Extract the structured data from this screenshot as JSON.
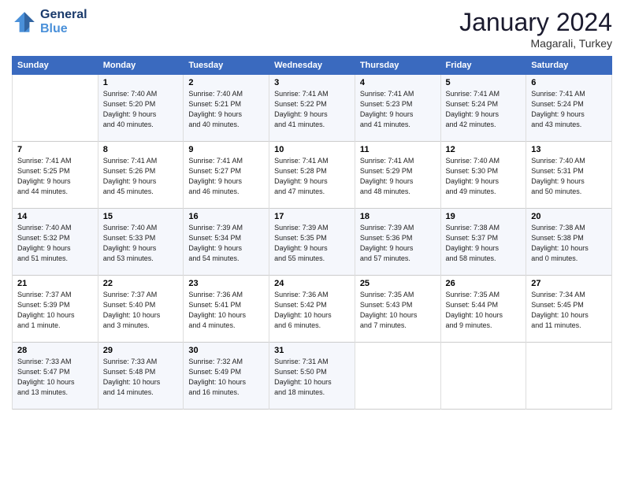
{
  "header": {
    "logo_line1": "General",
    "logo_line2": "Blue",
    "month_title": "January 2024",
    "location": "Magarali, Turkey"
  },
  "columns": [
    "Sunday",
    "Monday",
    "Tuesday",
    "Wednesday",
    "Thursday",
    "Friday",
    "Saturday"
  ],
  "weeks": [
    [
      {
        "day": "",
        "sunrise": "",
        "sunset": "",
        "daylight": ""
      },
      {
        "day": "1",
        "sunrise": "Sunrise: 7:40 AM",
        "sunset": "Sunset: 5:20 PM",
        "daylight": "Daylight: 9 hours and 40 minutes."
      },
      {
        "day": "2",
        "sunrise": "Sunrise: 7:40 AM",
        "sunset": "Sunset: 5:21 PM",
        "daylight": "Daylight: 9 hours and 40 minutes."
      },
      {
        "day": "3",
        "sunrise": "Sunrise: 7:41 AM",
        "sunset": "Sunset: 5:22 PM",
        "daylight": "Daylight: 9 hours and 41 minutes."
      },
      {
        "day": "4",
        "sunrise": "Sunrise: 7:41 AM",
        "sunset": "Sunset: 5:23 PM",
        "daylight": "Daylight: 9 hours and 41 minutes."
      },
      {
        "day": "5",
        "sunrise": "Sunrise: 7:41 AM",
        "sunset": "Sunset: 5:24 PM",
        "daylight": "Daylight: 9 hours and 42 minutes."
      },
      {
        "day": "6",
        "sunrise": "Sunrise: 7:41 AM",
        "sunset": "Sunset: 5:24 PM",
        "daylight": "Daylight: 9 hours and 43 minutes."
      }
    ],
    [
      {
        "day": "7",
        "sunrise": "Sunrise: 7:41 AM",
        "sunset": "Sunset: 5:25 PM",
        "daylight": "Daylight: 9 hours and 44 minutes."
      },
      {
        "day": "8",
        "sunrise": "Sunrise: 7:41 AM",
        "sunset": "Sunset: 5:26 PM",
        "daylight": "Daylight: 9 hours and 45 minutes."
      },
      {
        "day": "9",
        "sunrise": "Sunrise: 7:41 AM",
        "sunset": "Sunset: 5:27 PM",
        "daylight": "Daylight: 9 hours and 46 minutes."
      },
      {
        "day": "10",
        "sunrise": "Sunrise: 7:41 AM",
        "sunset": "Sunset: 5:28 PM",
        "daylight": "Daylight: 9 hours and 47 minutes."
      },
      {
        "day": "11",
        "sunrise": "Sunrise: 7:41 AM",
        "sunset": "Sunset: 5:29 PM",
        "daylight": "Daylight: 9 hours and 48 minutes."
      },
      {
        "day": "12",
        "sunrise": "Sunrise: 7:40 AM",
        "sunset": "Sunset: 5:30 PM",
        "daylight": "Daylight: 9 hours and 49 minutes."
      },
      {
        "day": "13",
        "sunrise": "Sunrise: 7:40 AM",
        "sunset": "Sunset: 5:31 PM",
        "daylight": "Daylight: 9 hours and 50 minutes."
      }
    ],
    [
      {
        "day": "14",
        "sunrise": "Sunrise: 7:40 AM",
        "sunset": "Sunset: 5:32 PM",
        "daylight": "Daylight: 9 hours and 51 minutes."
      },
      {
        "day": "15",
        "sunrise": "Sunrise: 7:40 AM",
        "sunset": "Sunset: 5:33 PM",
        "daylight": "Daylight: 9 hours and 53 minutes."
      },
      {
        "day": "16",
        "sunrise": "Sunrise: 7:39 AM",
        "sunset": "Sunset: 5:34 PM",
        "daylight": "Daylight: 9 hours and 54 minutes."
      },
      {
        "day": "17",
        "sunrise": "Sunrise: 7:39 AM",
        "sunset": "Sunset: 5:35 PM",
        "daylight": "Daylight: 9 hours and 55 minutes."
      },
      {
        "day": "18",
        "sunrise": "Sunrise: 7:39 AM",
        "sunset": "Sunset: 5:36 PM",
        "daylight": "Daylight: 9 hours and 57 minutes."
      },
      {
        "day": "19",
        "sunrise": "Sunrise: 7:38 AM",
        "sunset": "Sunset: 5:37 PM",
        "daylight": "Daylight: 9 hours and 58 minutes."
      },
      {
        "day": "20",
        "sunrise": "Sunrise: 7:38 AM",
        "sunset": "Sunset: 5:38 PM",
        "daylight": "Daylight: 10 hours and 0 minutes."
      }
    ],
    [
      {
        "day": "21",
        "sunrise": "Sunrise: 7:37 AM",
        "sunset": "Sunset: 5:39 PM",
        "daylight": "Daylight: 10 hours and 1 minute."
      },
      {
        "day": "22",
        "sunrise": "Sunrise: 7:37 AM",
        "sunset": "Sunset: 5:40 PM",
        "daylight": "Daylight: 10 hours and 3 minutes."
      },
      {
        "day": "23",
        "sunrise": "Sunrise: 7:36 AM",
        "sunset": "Sunset: 5:41 PM",
        "daylight": "Daylight: 10 hours and 4 minutes."
      },
      {
        "day": "24",
        "sunrise": "Sunrise: 7:36 AM",
        "sunset": "Sunset: 5:42 PM",
        "daylight": "Daylight: 10 hours and 6 minutes."
      },
      {
        "day": "25",
        "sunrise": "Sunrise: 7:35 AM",
        "sunset": "Sunset: 5:43 PM",
        "daylight": "Daylight: 10 hours and 7 minutes."
      },
      {
        "day": "26",
        "sunrise": "Sunrise: 7:35 AM",
        "sunset": "Sunset: 5:44 PM",
        "daylight": "Daylight: 10 hours and 9 minutes."
      },
      {
        "day": "27",
        "sunrise": "Sunrise: 7:34 AM",
        "sunset": "Sunset: 5:45 PM",
        "daylight": "Daylight: 10 hours and 11 minutes."
      }
    ],
    [
      {
        "day": "28",
        "sunrise": "Sunrise: 7:33 AM",
        "sunset": "Sunset: 5:47 PM",
        "daylight": "Daylight: 10 hours and 13 minutes."
      },
      {
        "day": "29",
        "sunrise": "Sunrise: 7:33 AM",
        "sunset": "Sunset: 5:48 PM",
        "daylight": "Daylight: 10 hours and 14 minutes."
      },
      {
        "day": "30",
        "sunrise": "Sunrise: 7:32 AM",
        "sunset": "Sunset: 5:49 PM",
        "daylight": "Daylight: 10 hours and 16 minutes."
      },
      {
        "day": "31",
        "sunrise": "Sunrise: 7:31 AM",
        "sunset": "Sunset: 5:50 PM",
        "daylight": "Daylight: 10 hours and 18 minutes."
      },
      {
        "day": "",
        "sunrise": "",
        "sunset": "",
        "daylight": ""
      },
      {
        "day": "",
        "sunrise": "",
        "sunset": "",
        "daylight": ""
      },
      {
        "day": "",
        "sunrise": "",
        "sunset": "",
        "daylight": ""
      }
    ]
  ]
}
